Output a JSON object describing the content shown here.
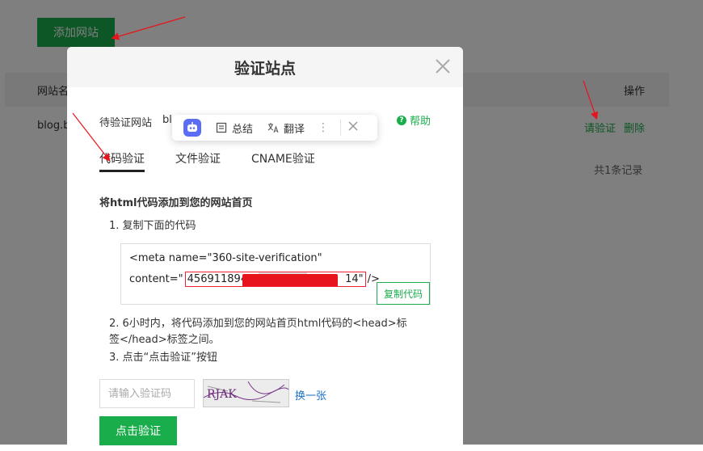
{
  "background": {
    "add_site_label": "添加网站",
    "col_name": "网站名",
    "col_operation": "操作",
    "row_site": "blog.be",
    "row_verify": "请验证",
    "row_delete": "删除",
    "total_records": "共1条记录"
  },
  "modal": {
    "title": "验证站点",
    "site_label": "待验证网站",
    "site_value": "bl",
    "help": "帮助",
    "tabs": [
      "代码验证",
      "文件验证",
      "CNAME验证"
    ],
    "active_tab": 0,
    "section_title": "将html代码添加到您的网站首页",
    "step1": "1. 复制下面的代码",
    "code_line1": "<meta name=\"360-site-verification\"",
    "code_prefix": "content=\"",
    "code_value_visible_start": "456911894",
    "code_value_visible_end": "14\"",
    "code_suffix": " />",
    "copy_button": "复制代码",
    "step2": "2. 6小时内，将代码添加到您的网站首页html代码的<head>标签</head>标签之间。",
    "step3": "3. 点击“点击验证”按钮",
    "captcha_placeholder": "请输入验证码",
    "captcha_text": "RJAK",
    "refresh_link": "换一张",
    "verify_button": "点击验证"
  },
  "float_toolbar": {
    "summary": "总结",
    "translate": "翻译"
  },
  "colors": {
    "accent": "#1aad4b",
    "link": "#1a73c9",
    "annotation_red": "#e8141b"
  }
}
